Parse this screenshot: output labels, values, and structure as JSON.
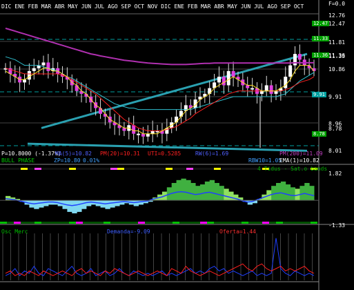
{
  "header": {
    "months_left": "DIC  ENE  FEB MAR ABR MAY JUN JUL  AGO SEP OCT NOV DIC  ENE  FEB MAR ABR MAY JUN JUL  AGO SEP OCT",
    "f_value": "F=0.0"
  },
  "price_scale": [
    "12.76",
    "12.47",
    "11.81",
    "11.33",
    "11.36",
    "10.86",
    "9.91",
    "8.96",
    "8.78",
    "8.01"
  ],
  "price_tags": [
    {
      "text": "12.47",
      "color": "#00a000"
    },
    {
      "text": "11.33",
      "color": "#00a000"
    },
    {
      "text": "11.36",
      "color": "#00a000"
    },
    {
      "text": "9.91",
      "color": "#00a0a0"
    },
    {
      "text": "8.78",
      "color": "#00a000"
    }
  ],
  "indicators_row1": [
    {
      "text": "P=10.8000  (-1.37%)",
      "color": "#ffffff"
    },
    {
      "text": "MA(5)=10.82",
      "color": "#5060ff"
    },
    {
      "text": "PM(20)=10.31",
      "color": "#ff2020"
    },
    {
      "text": "UTI=0.5285",
      "color": "#ff2020"
    },
    {
      "text": "RW(6)=1.69",
      "color": "#5060ff"
    },
    {
      "text": "PM(200)=11.09",
      "color": "#c040c0"
    }
  ],
  "indicators_row2": [
    {
      "text": "BULL PHASE",
      "color": "#00d000"
    },
    {
      "text": "ZP=10.80",
      "color": "#40a0ff"
    },
    {
      "text": "0.01%",
      "color": "#40a0ff"
    },
    {
      "text": "RBW10=1.05",
      "color": "#40a0ff"
    },
    {
      "text": "EMA(1)=10.82",
      "color": "#ffffff"
    }
  ],
  "mid_panel": {
    "title": "4 Tidus - Sat.o bands",
    "top_value": "1.82",
    "bottom_value": "-1.33"
  },
  "bottom_panel": {
    "label_left": "Osc Merc",
    "label_mid": "Demanda=-9.09",
    "label_right": "Oferta=1.44"
  },
  "chart_data": [
    {
      "type": "candlestick",
      "title": "",
      "ylim": [
        8.01,
        12.76
      ],
      "y_ticks": [
        12.76,
        12.47,
        11.81,
        11.33,
        11.36,
        10.86,
        9.91,
        8.96,
        8.78,
        8.01
      ],
      "x_labels": [
        "DIC",
        "ENE",
        "FEB",
        "MAR",
        "ABR",
        "MAY",
        "JUN",
        "JUL",
        "AGO",
        "SEP",
        "OCT",
        "NOV",
        "DIC",
        "ENE",
        "FEB",
        "MAR",
        "ABR",
        "MAY",
        "JUN",
        "JUL",
        "AGO",
        "SEP",
        "OCT"
      ],
      "close": [
        10.9,
        10.7,
        10.6,
        10.4,
        10.5,
        10.8,
        10.9,
        11.0,
        11.1,
        10.8,
        10.9,
        10.7,
        10.6,
        10.5,
        10.3,
        10.1,
        10.0,
        9.9,
        9.7,
        9.5,
        9.3,
        9.2,
        9.0,
        8.9,
        8.8,
        8.7,
        8.9,
        8.6,
        8.6,
        8.5,
        8.6,
        8.7,
        8.7,
        8.6,
        8.8,
        9.0,
        9.2,
        9.4,
        9.6,
        9.5,
        9.8,
        9.9,
        10.0,
        10.2,
        10.4,
        10.6,
        10.3,
        10.8,
        10.6,
        10.5,
        10.3,
        10.2,
        10.2,
        10.0,
        10.1,
        10.3,
        10.0,
        10.1,
        10.2,
        10.6,
        11.0,
        11.4,
        11.2,
        11.0,
        10.9,
        10.8
      ],
      "ma5": [
        10.8,
        10.7,
        10.6,
        10.5,
        10.5,
        10.6,
        10.7,
        10.8,
        10.9,
        10.9,
        10.8,
        10.8,
        10.7,
        10.6,
        10.4,
        10.3,
        10.1,
        10.0,
        9.8,
        9.6,
        9.5,
        9.3,
        9.1,
        9.0,
        8.9,
        8.8,
        8.8,
        8.7,
        8.7,
        8.6,
        8.6,
        8.6,
        8.6,
        8.7,
        8.8,
        8.9,
        9.0,
        9.2,
        9.4,
        9.5,
        9.6,
        9.8,
        9.9,
        10.0,
        10.2,
        10.3,
        10.4,
        10.5,
        10.6,
        10.5,
        10.4,
        10.3,
        10.3,
        10.2,
        10.1,
        10.1,
        10.1,
        10.1,
        10.2,
        10.3,
        10.5,
        10.8,
        11.0,
        11.0,
        11.0,
        10.8
      ],
      "pm20": [
        10.9,
        10.85,
        10.8,
        10.75,
        10.7,
        10.7,
        10.7,
        10.7,
        10.7,
        10.7,
        10.7,
        10.7,
        10.65,
        10.6,
        10.5,
        10.4,
        10.3,
        10.2,
        10.1,
        10.0,
        9.85,
        9.7,
        9.55,
        9.4,
        9.25,
        9.1,
        9.0,
        8.9,
        8.8,
        8.75,
        8.7,
        8.7,
        8.7,
        8.7,
        8.75,
        8.8,
        8.85,
        8.95,
        9.05,
        9.15,
        9.3,
        9.4,
        9.5,
        9.6,
        9.7,
        9.8,
        9.9,
        10.0,
        10.05,
        10.1,
        10.1,
        10.1,
        10.1,
        10.1,
        10.1,
        10.1,
        10.1,
        10.1,
        10.1,
        10.15,
        10.2,
        10.3,
        10.4,
        10.45,
        10.5,
        10.6
      ],
      "pm200": [
        12.3,
        12.25,
        12.2,
        12.15,
        12.1,
        12.05,
        12.0,
        11.95,
        11.9,
        11.85,
        11.8,
        11.75,
        11.7,
        11.65,
        11.6,
        11.55,
        11.5,
        11.45,
        11.4,
        11.37,
        11.33,
        11.3,
        11.27,
        11.24,
        11.21,
        11.18,
        11.16,
        11.14,
        11.12,
        11.1,
        11.08,
        11.07,
        11.06,
        11.05,
        11.04,
        11.03,
        11.03,
        11.03,
        11.03,
        11.04,
        11.05,
        11.06,
        11.07,
        11.07,
        11.08,
        11.08,
        11.08,
        11.08,
        11.08,
        11.08,
        11.08,
        11.08,
        11.08,
        11.08,
        11.08,
        11.08,
        11.08,
        11.08,
        11.08,
        11.08,
        11.08,
        11.09,
        11.09,
        11.09,
        11.09,
        11.09
      ],
      "ema_cyan": [
        11.3,
        11.25,
        11.2,
        11.1,
        11.0,
        11.0,
        11.0,
        11.0,
        10.95,
        10.9,
        10.85,
        10.8,
        10.7,
        10.6,
        10.55,
        10.45,
        10.35,
        10.25,
        10.15,
        10.05,
        9.95,
        9.85,
        9.75,
        9.65,
        9.6,
        9.55,
        9.5,
        9.5,
        9.45,
        9.45,
        9.45,
        9.45,
        9.45,
        9.45,
        9.45,
        9.45,
        9.45,
        9.45,
        9.45,
        9.45,
        9.5,
        9.55,
        9.6,
        9.65,
        9.7,
        9.75,
        9.8,
        9.85,
        9.9,
        9.9,
        9.9,
        9.9,
        9.9,
        9.9,
        9.9,
        9.9,
        9.9,
        9.9,
        9.95,
        10.0,
        10.15,
        10.3,
        10.45,
        10.55,
        10.65,
        10.75
      ],
      "trendlines": [
        {
          "x": [
            20,
            445
          ],
          "y": [
            8.8,
            11.4
          ],
          "color": "#2aa0b0"
        },
        {
          "x": [
            0,
            445
          ],
          "y": [
            8.25,
            8.0
          ],
          "color": "#2aa0b0"
        }
      ]
    },
    {
      "type": "area",
      "title": "4 Tidus - Sat.o bands",
      "ylim": [
        -1.33,
        1.82
      ],
      "values": [
        0.3,
        0.2,
        0.1,
        -0.1,
        -0.3,
        -0.5,
        -0.6,
        -0.5,
        -0.4,
        -0.3,
        -0.3,
        -0.4,
        -0.6,
        -0.8,
        -0.9,
        -0.8,
        -0.6,
        -0.4,
        -0.3,
        -0.4,
        -0.5,
        -0.6,
        -0.5,
        -0.4,
        -0.3,
        -0.2,
        -0.3,
        -0.4,
        -0.3,
        -0.2,
        -0.1,
        0.2,
        0.4,
        0.6,
        0.9,
        1.2,
        1.4,
        1.5,
        1.4,
        1.2,
        1.0,
        1.1,
        1.3,
        1.4,
        1.2,
        1.0,
        0.8,
        0.6,
        0.4,
        0.2,
        -0.1,
        -0.3,
        -0.2,
        0.1,
        0.4,
        0.7,
        1.0,
        1.2,
        1.3,
        1.1,
        0.9,
        0.8,
        1.0,
        1.2,
        1.0,
        0.8
      ]
    },
    {
      "type": "line",
      "title": "Osc Merc",
      "series": [
        {
          "name": "Demanda",
          "values": [
            2,
            3,
            5,
            2,
            4,
            3,
            6,
            3,
            2,
            5,
            4,
            3,
            2,
            4,
            6,
            3,
            2,
            3,
            5,
            2,
            3,
            4,
            2,
            3,
            5,
            3,
            2,
            4,
            3,
            2,
            3,
            2,
            3,
            4,
            2,
            3,
            2,
            3,
            4,
            5,
            3,
            4,
            3,
            5,
            6,
            4,
            5,
            3,
            4,
            3,
            2,
            3,
            4,
            2,
            3,
            2,
            3,
            18,
            5,
            3,
            2,
            4,
            3,
            2,
            3,
            2
          ]
        },
        {
          "name": "Oferta",
          "values": [
            3,
            4,
            2,
            3,
            2,
            4,
            3,
            2,
            4,
            3,
            2,
            3,
            4,
            3,
            2,
            4,
            5,
            3,
            4,
            3,
            2,
            4,
            3,
            5,
            4,
            3,
            2,
            3,
            4,
            3,
            2,
            3,
            4,
            3,
            2,
            5,
            4,
            3,
            6,
            4,
            3,
            2,
            3,
            4,
            3,
            2,
            3,
            4,
            5,
            6,
            7,
            5,
            4,
            6,
            7,
            5,
            4,
            5,
            6,
            4,
            5,
            4,
            5,
            6,
            4,
            3
          ]
        }
      ]
    }
  ]
}
